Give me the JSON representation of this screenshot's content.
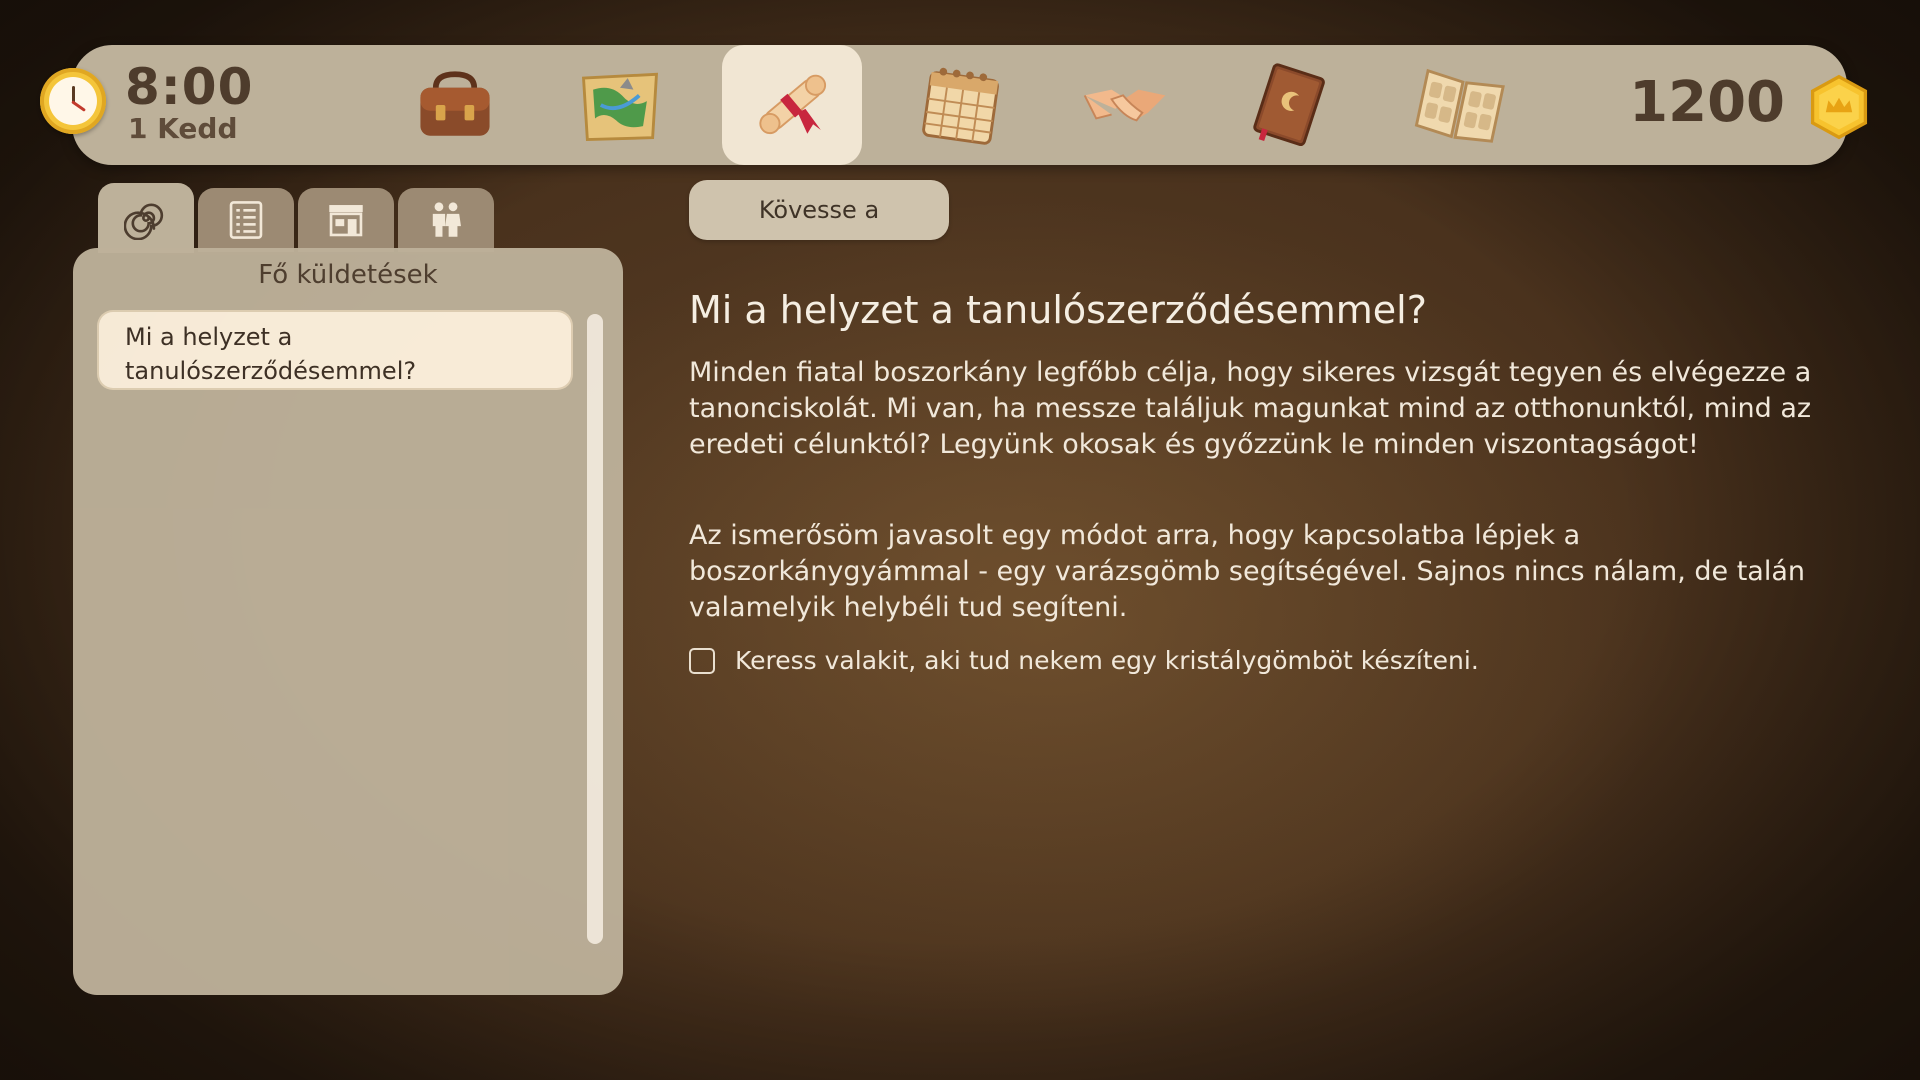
{
  "clock": {
    "time": "8:00",
    "day": "1 Kedd"
  },
  "nav": [
    {
      "id": "inventory",
      "icon": "satchel-icon"
    },
    {
      "id": "map",
      "icon": "map-icon"
    },
    {
      "id": "quests",
      "icon": "scroll-icon",
      "active": true
    },
    {
      "id": "calendar",
      "icon": "calendar-icon"
    },
    {
      "id": "relationships",
      "icon": "handshake-icon"
    },
    {
      "id": "spellbook",
      "icon": "book-icon"
    },
    {
      "id": "recipes",
      "icon": "recipe-book-icon"
    }
  ],
  "currency": {
    "amount": "1200",
    "icon": "coin-icon"
  },
  "tabs": [
    {
      "id": "main",
      "icon": "spiral-icon",
      "active": true
    },
    {
      "id": "tasks",
      "icon": "checklist-icon"
    },
    {
      "id": "shop",
      "icon": "shop-icon"
    },
    {
      "id": "people",
      "icon": "people-icon"
    }
  ],
  "quest_list": {
    "title": "Fő küldetések",
    "items": [
      {
        "label": "Mi a helyzet a tanulószerződésemmel?",
        "selected": true
      }
    ]
  },
  "detail": {
    "follow_label": "Kövesse a",
    "title": "Mi a helyzet a tanulószerződésemmel?",
    "paragraphs": [
      "Minden fiatal boszorkány legfőbb célja, hogy sikeres vizsgát tegyen és elvégezze a tanonciskolát. Mi van, ha messze találjuk magunkat mind az otthonunktól, mind az eredeti célunktól? Legyünk okosak és győzzünk le minden viszontagságot!",
      "Az ismerősöm javasolt egy módot arra, hogy kapcsolatba lépjek a boszorkánygyámmal - egy varázsgömb segítségével. Sajnos nincs nálam, de talán valamelyik helybéli tud segíteni."
    ],
    "objectives": [
      {
        "text": "Keress valakit, aki tud nekem egy kristálygömböt készíteni.",
        "done": false
      }
    ]
  },
  "colors": {
    "panel": "#bdb19a",
    "active_tab": "#f1e6d3",
    "text_dark": "#4e3c2c",
    "text_light": "#f1e8da",
    "coin": "#f4c53a"
  }
}
